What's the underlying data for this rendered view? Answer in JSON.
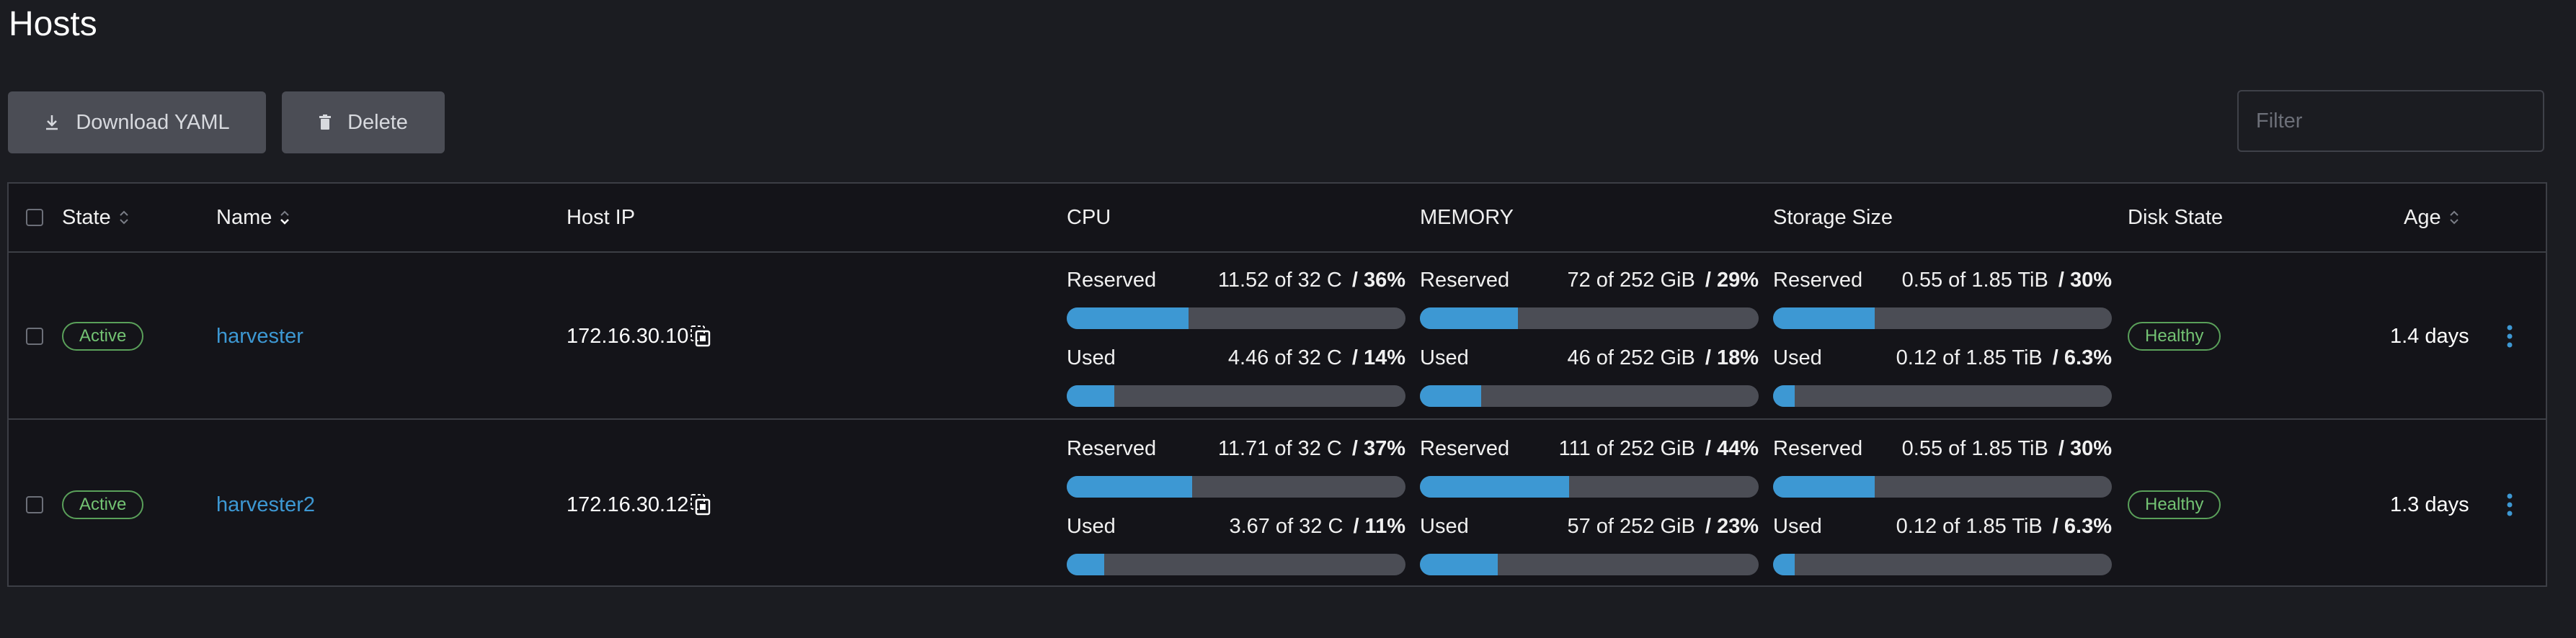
{
  "page": {
    "title": "Hosts"
  },
  "toolbar": {
    "download_label": "Download YAML",
    "delete_label": "Delete",
    "filter_placeholder": "Filter"
  },
  "columns": {
    "state": "State",
    "name": "Name",
    "host_ip": "Host IP",
    "cpu": "CPU",
    "memory": "MEMORY",
    "storage": "Storage Size",
    "disk_state": "Disk State",
    "age": "Age"
  },
  "colors": {
    "accent": "#3d98d3",
    "active_badge": "#73c373",
    "bar_track": "#4b4d55"
  },
  "rows": [
    {
      "state": "Active",
      "name": "harvester",
      "host_ip": "172.16.30.10",
      "cpu": {
        "reserved": {
          "label": "Reserved",
          "value": "11.52 of 32 C",
          "pct": "/ 36%",
          "fraction": 0.36
        },
        "used": {
          "label": "Used",
          "value": "4.46 of 32 C",
          "pct": "/ 14%",
          "fraction": 0.14
        }
      },
      "memory": {
        "reserved": {
          "label": "Reserved",
          "value": "72 of 252 GiB",
          "pct": "/ 29%",
          "fraction": 0.29
        },
        "used": {
          "label": "Used",
          "value": "46 of 252 GiB",
          "pct": "/ 18%",
          "fraction": 0.18
        }
      },
      "storage": {
        "reserved": {
          "label": "Reserved",
          "value": "0.55 of 1.85 TiB",
          "pct": "/ 30%",
          "fraction": 0.3
        },
        "used": {
          "label": "Used",
          "value": "0.12 of 1.85 TiB",
          "pct": "/ 6.3%",
          "fraction": 0.063
        }
      },
      "disk_state": "Healthy",
      "age": "1.4 days"
    },
    {
      "state": "Active",
      "name": "harvester2",
      "host_ip": "172.16.30.12",
      "cpu": {
        "reserved": {
          "label": "Reserved",
          "value": "11.71 of 32 C",
          "pct": "/ 37%",
          "fraction": 0.37
        },
        "used": {
          "label": "Used",
          "value": "3.67 of 32 C",
          "pct": "/ 11%",
          "fraction": 0.11
        }
      },
      "memory": {
        "reserved": {
          "label": "Reserved",
          "value": "111 of 252 GiB",
          "pct": "/ 44%",
          "fraction": 0.44
        },
        "used": {
          "label": "Used",
          "value": "57 of 252 GiB",
          "pct": "/ 23%",
          "fraction": 0.23
        }
      },
      "storage": {
        "reserved": {
          "label": "Reserved",
          "value": "0.55 of 1.85 TiB",
          "pct": "/ 30%",
          "fraction": 0.3
        },
        "used": {
          "label": "Used",
          "value": "0.12 of 1.85 TiB",
          "pct": "/ 6.3%",
          "fraction": 0.063
        }
      },
      "disk_state": "Healthy",
      "age": "1.3 days"
    }
  ]
}
